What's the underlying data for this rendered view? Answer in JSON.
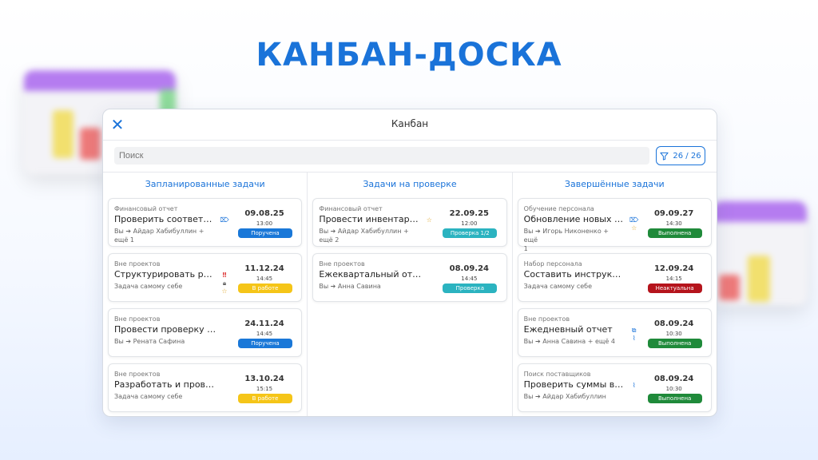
{
  "headline": "КАНБАН-ДОСКА",
  "window": {
    "title": "Канбан",
    "search_placeholder": "Поиск",
    "filter_count": "26 / 26"
  },
  "columns": [
    {
      "title": "Запланированные задачи",
      "cards": [
        {
          "project": "Финансовый отчет",
          "title": "Проверить соответств...",
          "assign1": "Вы ➔ Айдар Хабибуллин +",
          "assign2": "ещё 1",
          "date": "09.08.25",
          "time": "13:00",
          "status": "Поручена",
          "status_color": "blue",
          "icons": [
            "tag-icon"
          ]
        },
        {
          "project": "Вне проектов",
          "title": "Структурировать расх...",
          "assign1": "Задача самому себе",
          "assign2": "",
          "date": "11.12.24",
          "time": "14:45",
          "status": "В работе",
          "status_color": "yellow",
          "icons": [
            "priority-icon",
            "lock-icon",
            "star-icon"
          ]
        },
        {
          "project": "Вне проектов",
          "title": "Провести проверку обор...",
          "assign1": "Вы ➔ Рената Сафина",
          "assign2": "",
          "date": "24.11.24",
          "time": "14:45",
          "status": "Поручена",
          "status_color": "blue",
          "icons": []
        },
        {
          "project": "Вне проектов",
          "title": "Разработать и провести р...",
          "assign1": "Задача самому себе",
          "assign2": "",
          "date": "13.10.24",
          "time": "15:15",
          "status": "В работе",
          "status_color": "yellow",
          "icons": []
        }
      ]
    },
    {
      "title": "Задачи на проверке",
      "cards": [
        {
          "project": "Финансовый отчет",
          "title": "Провести инвентаризац...",
          "assign1": "Вы ➔ Айдар Хабибуллин +",
          "assign2": "ещё 2",
          "date": "22.09.25",
          "time": "12:00",
          "status": "Проверка 1/2",
          "status_color": "teal",
          "icons": [
            "star-icon"
          ]
        },
        {
          "project": "Вне проектов",
          "title": "Ежеквартальный отчет",
          "assign1": "Вы ➔ Анна Савина",
          "assign2": "",
          "date": "08.09.24",
          "time": "14:45",
          "status": "Проверка",
          "status_color": "teal",
          "icons": []
        }
      ]
    },
    {
      "title": "Завершённые задачи",
      "cards": [
        {
          "project": "Обучение персонала",
          "title": "Обновление новых ПО...",
          "assign1": "Вы ➔ Игорь Никоненко + ещё",
          "assign2": "1",
          "date": "09.09.27",
          "time": "14:30",
          "status": "Выполнена",
          "status_color": "green",
          "icons": [
            "tag-icon",
            "star-icon"
          ]
        },
        {
          "project": "Набор персонала",
          "title": "Составить инструкцию - ...",
          "assign1": "Задача самому себе",
          "assign2": "",
          "date": "12.09.24",
          "time": "14:15",
          "status": "Неактуальна",
          "status_color": "red",
          "icons": []
        },
        {
          "project": "Вне проектов",
          "title": "Ежедневный отчет",
          "assign1": "Вы ➔ Анна Савина + ещё 4",
          "assign2": "",
          "date": "08.09.24",
          "time": "10:30",
          "status": "Выполнена",
          "status_color": "green",
          "icons": [
            "copy-icon",
            "paperclip-icon"
          ]
        },
        {
          "project": "Поиск поставщиков",
          "title": "Проверить суммы в дог...",
          "assign1": "Вы ➔ Айдар Хабибуллин",
          "assign2": "",
          "date": "08.09.24",
          "time": "10:30",
          "status": "Выполнена",
          "status_color": "green",
          "icons": [
            "paperclip-icon"
          ]
        }
      ]
    }
  ]
}
